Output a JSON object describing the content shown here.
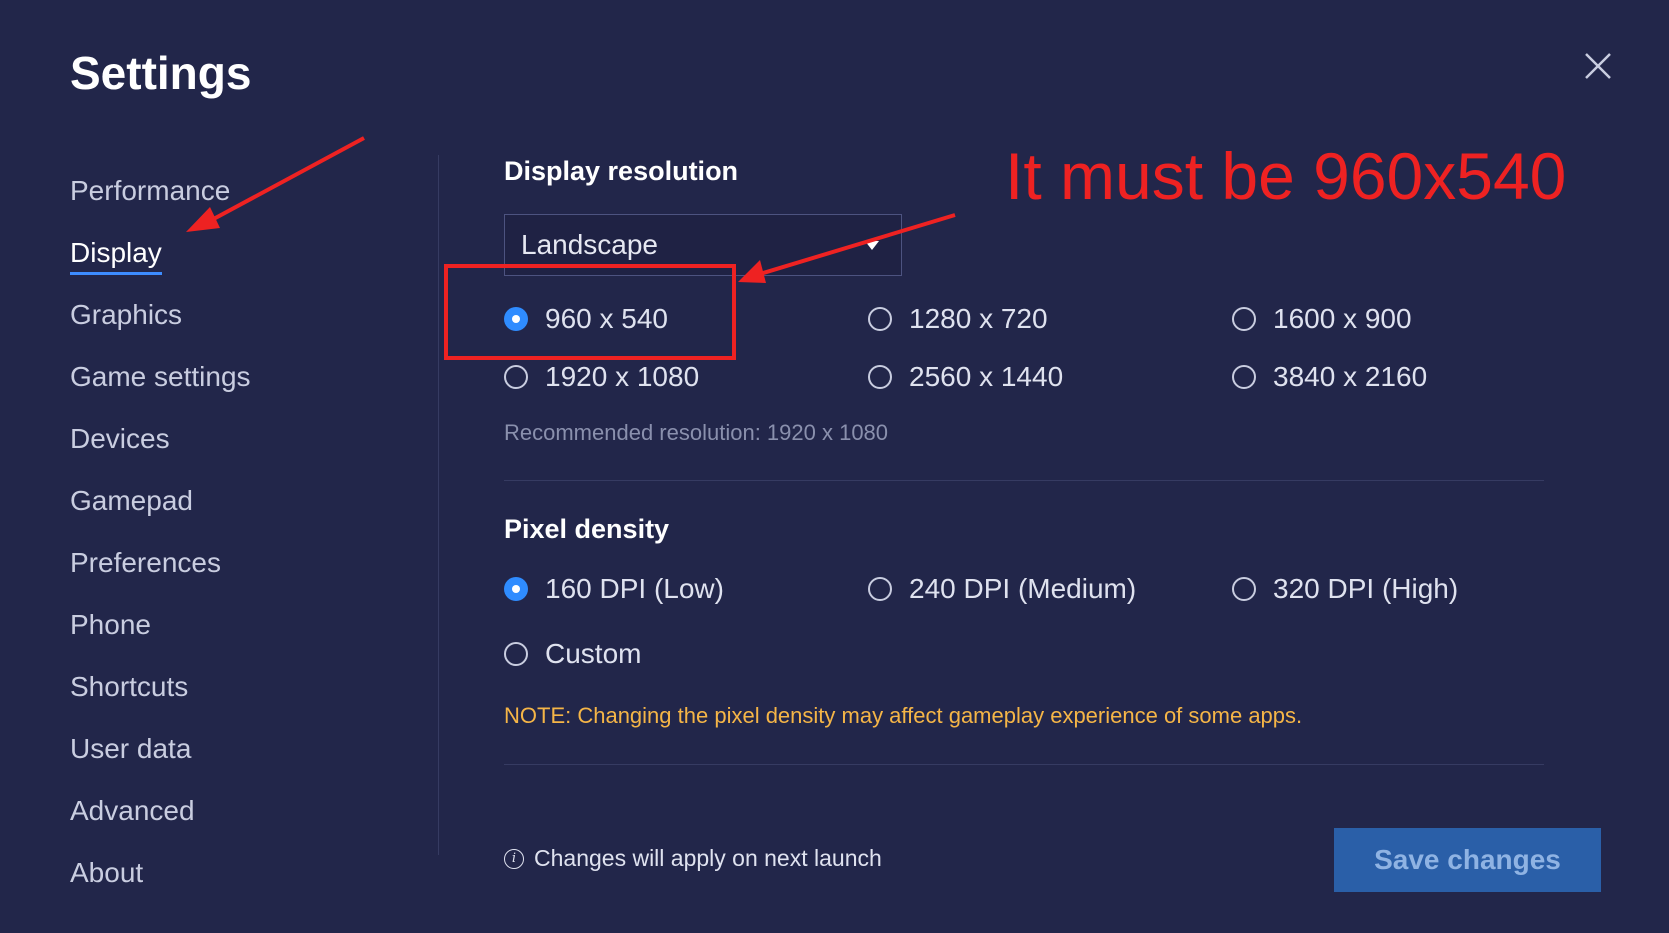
{
  "window": {
    "title": "Settings",
    "close_icon": "close-icon"
  },
  "sidebar": {
    "items": [
      {
        "label": "Performance",
        "active": false
      },
      {
        "label": "Display",
        "active": true
      },
      {
        "label": "Graphics",
        "active": false
      },
      {
        "label": "Game settings",
        "active": false
      },
      {
        "label": "Devices",
        "active": false
      },
      {
        "label": "Gamepad",
        "active": false
      },
      {
        "label": "Preferences",
        "active": false
      },
      {
        "label": "Phone",
        "active": false
      },
      {
        "label": "Shortcuts",
        "active": false
      },
      {
        "label": "User data",
        "active": false
      },
      {
        "label": "Advanced",
        "active": false
      },
      {
        "label": "About",
        "active": false
      }
    ]
  },
  "display_resolution": {
    "title": "Display resolution",
    "orientation_selected": "Landscape",
    "options": [
      {
        "label": "960 x 540",
        "selected": true
      },
      {
        "label": "1280 x 720",
        "selected": false
      },
      {
        "label": "1600 x 900",
        "selected": false
      },
      {
        "label": "1920 x 1080",
        "selected": false
      },
      {
        "label": "2560 x 1440",
        "selected": false
      },
      {
        "label": "3840 x 2160",
        "selected": false
      }
    ],
    "recommended": "Recommended resolution: 1920 x 1080"
  },
  "pixel_density": {
    "title": "Pixel density",
    "options": [
      {
        "label": "160 DPI (Low)",
        "selected": true
      },
      {
        "label": "240 DPI (Medium)",
        "selected": false
      },
      {
        "label": "320 DPI (High)",
        "selected": false
      },
      {
        "label": "Custom",
        "selected": false
      }
    ],
    "note": "NOTE: Changing the pixel density may affect gameplay experience of some apps."
  },
  "footer": {
    "info_text": "Changes will apply on next launch",
    "info_icon": "info-icon",
    "save_label": "Save changes"
  },
  "annotation": {
    "text": "It must be 960x540",
    "color": "#ee2222"
  },
  "colors": {
    "background": "#22264a",
    "accent": "#2f8cff",
    "save_button": "#2a5fa8",
    "note": "#f5b547"
  }
}
